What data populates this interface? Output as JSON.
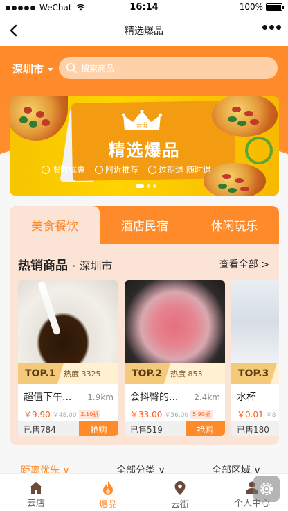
{
  "statusbar": {
    "carrier": "WeChat",
    "time": "16:14",
    "battery": "100%"
  },
  "navbar": {
    "title": "精选爆品"
  },
  "header": {
    "city": "深圳市",
    "search_placeholder": "搜索商品"
  },
  "banner": {
    "crown_text": "云街",
    "title": "精选爆品",
    "badges": [
      "限时优惠",
      "附近推荐",
      "过期退 随时退"
    ]
  },
  "tabs": [
    {
      "label": "美食餐饮",
      "active": true
    },
    {
      "label": "酒店民宿",
      "active": false
    },
    {
      "label": "休闲玩乐",
      "active": false
    }
  ],
  "section": {
    "title": "热销商品",
    "city": "· 深圳市",
    "more": "查看全部 >"
  },
  "products": [
    {
      "top": "TOP.1",
      "heat": "热度 3325",
      "name": "超值下午...",
      "distance": "1.9km",
      "price": "￥9.90",
      "original_price": "￥48.00",
      "discount": "2.10折",
      "sold": "已售784",
      "buy": "抢购"
    },
    {
      "top": "TOP.2",
      "heat": "热度 853",
      "name": "会抖臀的...",
      "distance": "2.4km",
      "price": "￥33.00",
      "original_price": "￥56.00",
      "discount": "5.90折",
      "sold": "已售519",
      "buy": "抢购"
    },
    {
      "top": "TOP.3",
      "heat": "",
      "name": "水杯",
      "distance": "",
      "price": "￥0.01",
      "original_price": "￥8",
      "discount": "",
      "sold": "已售180",
      "buy": ""
    }
  ],
  "filters": [
    "距离优先 ∨",
    "全部分类 ∨",
    "全部区域 ∨"
  ],
  "tabbar": [
    {
      "label": "云店",
      "icon": "home-icon",
      "active": false
    },
    {
      "label": "爆品",
      "icon": "flame-icon",
      "active": true
    },
    {
      "label": "云街",
      "icon": "location-pin-icon",
      "active": false
    },
    {
      "label": "个人中心",
      "icon": "user-icon",
      "active": false
    }
  ],
  "colors": {
    "accent": "#ff8a2a",
    "price": "#ff5a14",
    "card_bg": "#fbe3d5",
    "banner_yellow": "#ffd400"
  }
}
